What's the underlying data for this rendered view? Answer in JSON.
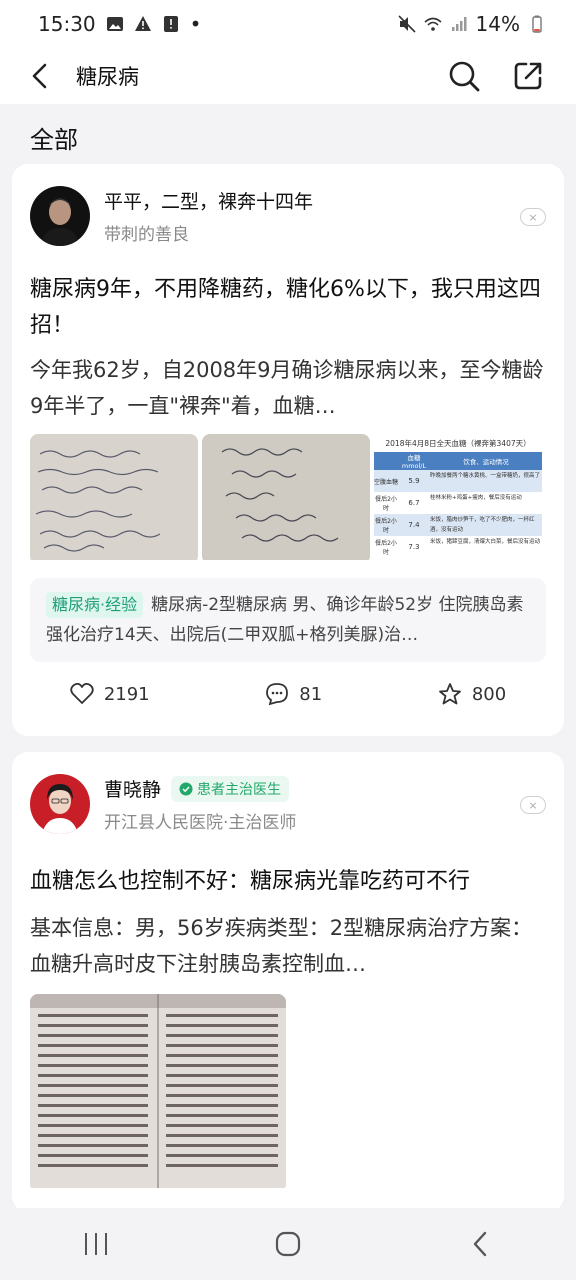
{
  "status": {
    "time": "15:30",
    "battery": "14%",
    "dot": "•"
  },
  "header": {
    "title": "糖尿病"
  },
  "section": {
    "label": "全部"
  },
  "posts": [
    {
      "author_name": "平平，二型，裸奔十四年",
      "author_sub": "带刺的善良",
      "dismiss": "×",
      "title": "糖尿病9年，不用降糖药，糖化6%以下，我只用这四招！",
      "body": "今年我62岁，自2008年9月确诊糖尿病以来，至今糖龄9年半了，一直\"裸奔\"着，血糖…",
      "image3": {
        "title": "2018年4月8日全天血糖（裸奔第3407天）",
        "headers": [
          "",
          "血糖 mmol/L",
          "饮食、运动情况"
        ],
        "rows": [
          [
            "空腹血糖",
            "5.9",
            "昨晚加餐两个糖水黄桃、一盒带糖奶，很高了"
          ],
          [
            "餐后2小时",
            "6.7",
            "桂林米粉+鸡蛋+瘦肉，餐后没有运动"
          ],
          [
            "餐后2小时",
            "7.4",
            "米饭，腊肉炒笋干，吃了不少肥肉，一杯红酒，没有运动"
          ],
          [
            "餐后2小时",
            "7.3",
            "米饭，猪蹄豆腐，清爆大白菜，餐后没有运动"
          ]
        ]
      },
      "tag": "糖尿病·经验",
      "tag_text": "糖尿病-2型糖尿病 男、确诊年龄52岁 住院胰岛素强化治疗14天、出院后(二甲双胍+格列美脲)治…",
      "likes": "2191",
      "comments": "81",
      "favorites": "800"
    },
    {
      "author_name": "曹晓静",
      "badge": "患者主治医生",
      "author_sub": "开江县人民医院·主治医师",
      "dismiss": "×",
      "title": "血糖怎么也控制不好：糖尿病光靠吃药可不行",
      "body": "基本信息：男，56岁疾病类型：2型糖尿病治疗方案：血糖升高时皮下注射胰岛素控制血…"
    }
  ],
  "colors": {
    "accent_green": "#23a86b",
    "table_blue": "#4a7fc1"
  }
}
